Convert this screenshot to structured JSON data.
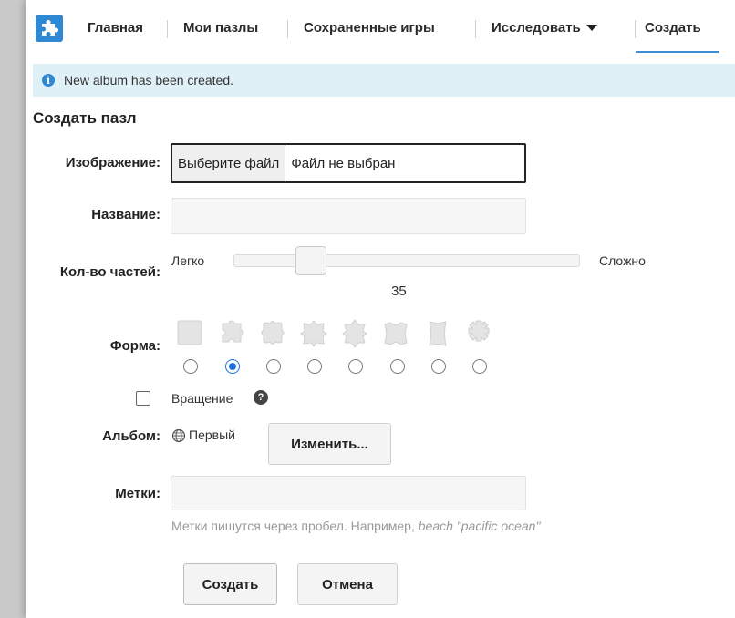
{
  "nav": {
    "items": [
      {
        "label": "Главная"
      },
      {
        "label": "Мои пазлы"
      },
      {
        "label": "Сохраненные игры"
      },
      {
        "label": "Исследовать"
      },
      {
        "label": "Создать"
      }
    ],
    "active_index": 4
  },
  "alert": {
    "message": "New album has been created."
  },
  "form": {
    "title": "Создать пазл",
    "image": {
      "label": "Изображение:",
      "button": "Выберите файл",
      "status": "Файл не выбран"
    },
    "name": {
      "label": "Название:",
      "value": ""
    },
    "pieces": {
      "label": "Кол-во частей:",
      "min_label": "Легко",
      "max_label": "Сложно",
      "value": "35"
    },
    "shape": {
      "label": "Форма:",
      "options": [
        "square",
        "classic",
        "rounded",
        "flat",
        "star",
        "puzzle",
        "wave",
        "gear"
      ],
      "selected_index": 1
    },
    "rotation": {
      "label": "Вращение",
      "checked": false
    },
    "album": {
      "label": "Альбом:",
      "value": "Первый",
      "change_button": "Изменить..."
    },
    "tags": {
      "label": "Метки:",
      "value": "",
      "hint": "Метки пишутся через пробел. Например,",
      "hint_example": "beach \"pacific ocean\""
    },
    "submit_button": "Создать",
    "cancel_button": "Отмена"
  },
  "colors": {
    "accent": "#2e88d4",
    "alert_bg": "#dff0f7",
    "radio_selected": "#1a73e8"
  }
}
